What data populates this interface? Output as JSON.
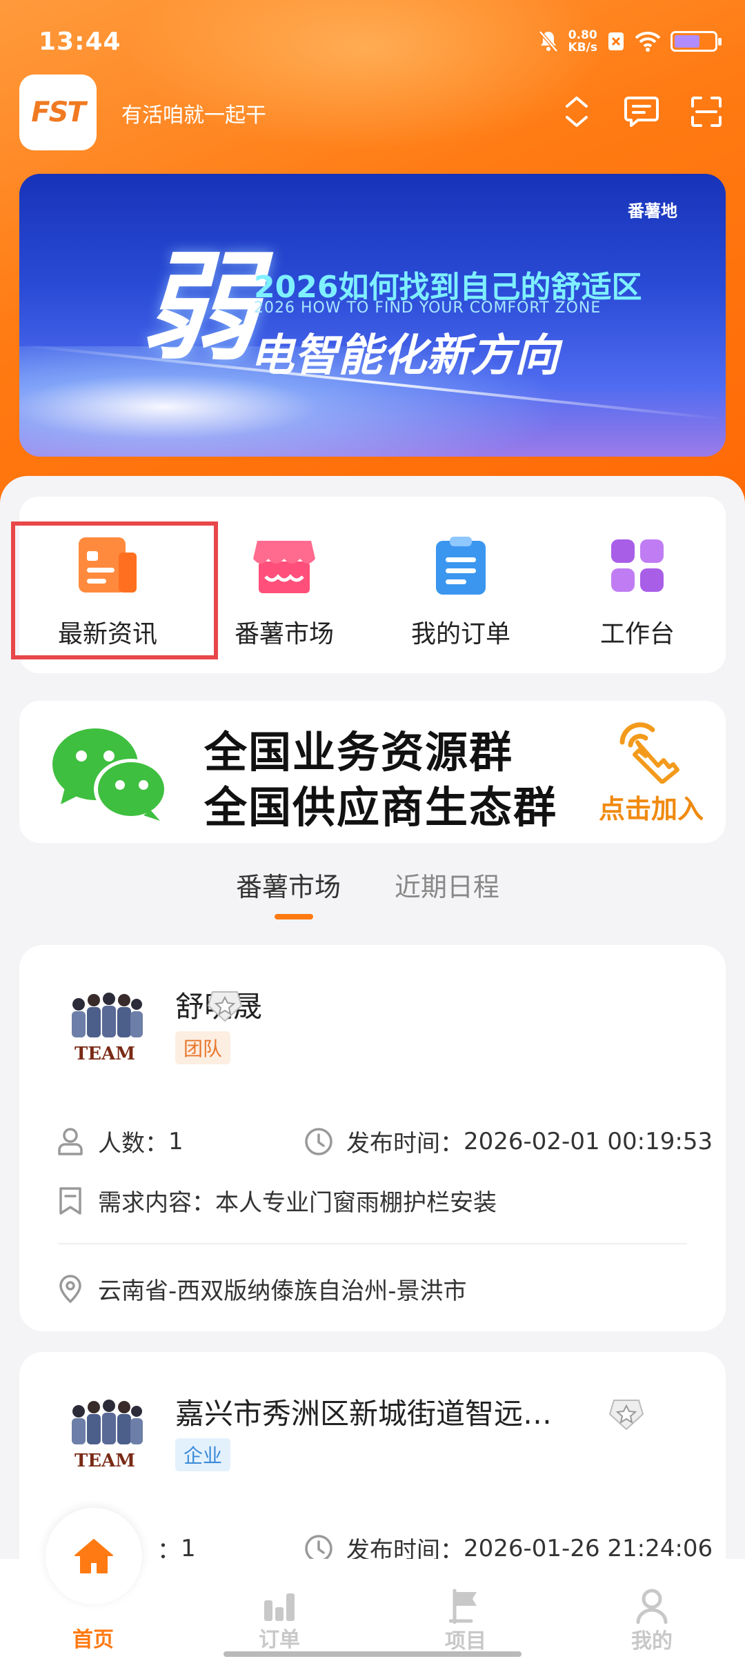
{
  "status_bar": {
    "time": "13:44",
    "net_speed": "0.80",
    "net_unit": "KB/s",
    "battery_level": 0.65
  },
  "app_bar": {
    "logo_text": "FST",
    "slogan": "有活咱就一起干"
  },
  "banner": {
    "tag": "番薯地",
    "big_char": "弱",
    "title": "2026如何找到自己的舒适区",
    "subtitle_en": "2026  HOW TO FIND YOUR COMFORT ZONE",
    "subtitle": "电智能化新方向"
  },
  "quick_menu": [
    {
      "label": "最新资讯",
      "icon": "news-icon"
    },
    {
      "label": "番薯市场",
      "icon": "store-icon"
    },
    {
      "label": "我的订单",
      "icon": "clipboard-icon"
    },
    {
      "label": "工作台",
      "icon": "grid-icon"
    }
  ],
  "wechat_banner": {
    "line1": "全国业务资源群",
    "line2": "全国供应商生态群",
    "join": "点击加入"
  },
  "tabs": {
    "market": "番薯市场",
    "schedule": "近期日程"
  },
  "cards": [
    {
      "name": "舒明晟",
      "badge": "团队",
      "avatar_text": "TEAM",
      "people_label": "人数：",
      "people": "1",
      "time_label": "发布时间：",
      "time": "2026-02-01 00:19:53",
      "demand_label": "需求内容：",
      "demand": "本人专业门窗雨棚护栏安装",
      "location": "云南省-西双版纳傣族自治州-景洪市"
    },
    {
      "name": "嘉兴市秀洲区新城街道智远…",
      "badge": "企业",
      "avatar_text": "TEAM",
      "people_label": "：",
      "people": "1",
      "time_label": "发布时间：",
      "time": "2026-01-26 21:24:06"
    }
  ],
  "nav": {
    "home": "首页",
    "orders": "订单",
    "projects": "项目",
    "mine": "我的"
  },
  "colors": {
    "brand_orange": "#ff7a12",
    "highlight_red": "#e8474a",
    "nav_inactive": "#c8c8c8"
  }
}
